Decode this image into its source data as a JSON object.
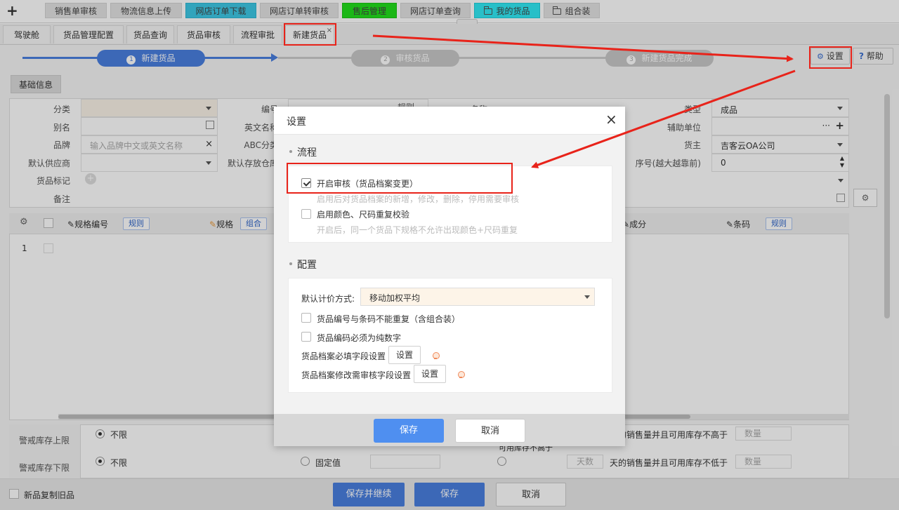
{
  "top_tabs": [
    {
      "label": "销售单审核",
      "color": "#e3e3e3",
      "folder": false
    },
    {
      "label": "物流信息上传",
      "color": "#e3e3e3",
      "folder": false
    },
    {
      "label": "网店订单下载",
      "color": "#3ec9e6",
      "folder": false
    },
    {
      "label": "网店订单转审核",
      "color": "#e3e3e3",
      "folder": false
    },
    {
      "label": "售后管理",
      "color": "#22e01c",
      "folder": false
    },
    {
      "label": "网店订单查询",
      "color": "#e3e3e3",
      "folder": false
    },
    {
      "label": "我的货品",
      "color": "#31e9f5",
      "folder": true
    },
    {
      "label": "组合装",
      "color": "#e3e3e3",
      "folder": true
    }
  ],
  "sub_tabs": [
    "驾驶舱",
    "货品管理配置",
    "货品查询",
    "货品审核",
    "流程审批",
    "新建货品"
  ],
  "steps": [
    {
      "num": "1",
      "label": "新建货品"
    },
    {
      "num": "2",
      "label": "审核货品"
    },
    {
      "num": "3",
      "label": "新建货品完成"
    }
  ],
  "header_buttons": {
    "settings": "设置",
    "help": "帮助"
  },
  "basic_info_tab": "基础信息",
  "form": {
    "row1": {
      "category": "分类",
      "code": "编号",
      "rule": "规则",
      "name": "名称",
      "type_label": "类型",
      "type_value": "成品"
    },
    "row2": {
      "alias": "别名",
      "en_name": "英文名称",
      "aux_unit": "辅助单位"
    },
    "row3": {
      "brand": "品牌",
      "brand_placeholder": "输入品牌中文或英文名称",
      "abc": "ABC分类",
      "owner": "货主",
      "owner_value": "吉客云OA公司"
    },
    "row4": {
      "supplier": "默认供应商",
      "storage": "默认存放仓库",
      "order": "序号(越大越靠前)",
      "order_value": "0"
    },
    "row5": {
      "mark": "货品标记"
    },
    "row6": {
      "remark": "备注"
    }
  },
  "grid": {
    "spec_code": "规格编号",
    "rule": "规则",
    "spec": "规格",
    "combo": "组合",
    "component": "成分",
    "barcode": "条码",
    "row1": "1"
  },
  "stock": {
    "upper_label": "警戒库存上限",
    "lower_label": "警戒库存下限",
    "unlimited": "不限",
    "fixed": "固定值",
    "days": "天数",
    "upper_desc": "天的销售量并且可用库存不高于",
    "lower_desc": "天的销售量并且可用库存不低于",
    "qty": "数量",
    "partial": "可用库存不高于"
  },
  "bottom": {
    "copy_old": "新品复制旧品",
    "save_continue": "保存并继续",
    "save": "保存",
    "cancel": "取消"
  },
  "modal": {
    "title": "设置",
    "section_flow": "流程",
    "flow_items": [
      {
        "label": "开启审核（货品档案变更）",
        "hint": "启用后对货品档案的新增，修改，删除，停用需要审核",
        "checked": true
      },
      {
        "label": "启用颜色、尺码重复校验",
        "hint": "开启后，同一个货品下规格不允许出现颜色+尺码重复",
        "checked": false
      }
    ],
    "section_config": "配置",
    "pricing_label": "默认计价方式:",
    "pricing_value": "移动加权平均",
    "config_items": [
      {
        "label": "货品编号与条码不能重复（含组合装）",
        "checked": false
      },
      {
        "label": "货品编码必须为纯数字",
        "checked": false
      }
    ],
    "required_fields": "货品档案必填字段设置",
    "audit_fields": "货品档案修改需审核字段设置",
    "set_button": "设置",
    "save": "保存",
    "cancel": "取消"
  },
  "colors": {
    "accent": "#4a7fe0",
    "modal_save": "#4f8ff0",
    "annotation_red": "#e8231a"
  }
}
